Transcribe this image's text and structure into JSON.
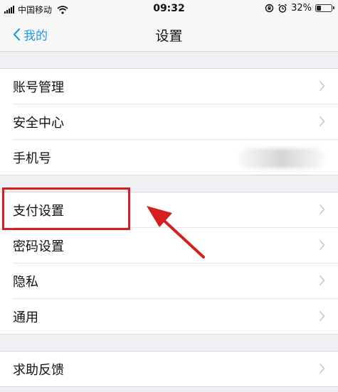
{
  "status_bar": {
    "carrier": "中国移动",
    "time": "09:32",
    "battery": "32%",
    "battery_level": 0.32
  },
  "nav": {
    "back_label": "我的",
    "title": "设置"
  },
  "groups": [
    {
      "items": [
        {
          "label": "账号管理"
        },
        {
          "label": "安全中心"
        },
        {
          "label": "手机号"
        }
      ]
    },
    {
      "items": [
        {
          "label": "支付设置"
        },
        {
          "label": "密码设置"
        },
        {
          "label": "隐私"
        },
        {
          "label": "通用"
        }
      ]
    },
    {
      "items": [
        {
          "label": "求助反馈"
        }
      ]
    }
  ],
  "colors": {
    "accent": "#1e9be0",
    "highlight": "#d51e1e",
    "background": "#efeff4"
  }
}
